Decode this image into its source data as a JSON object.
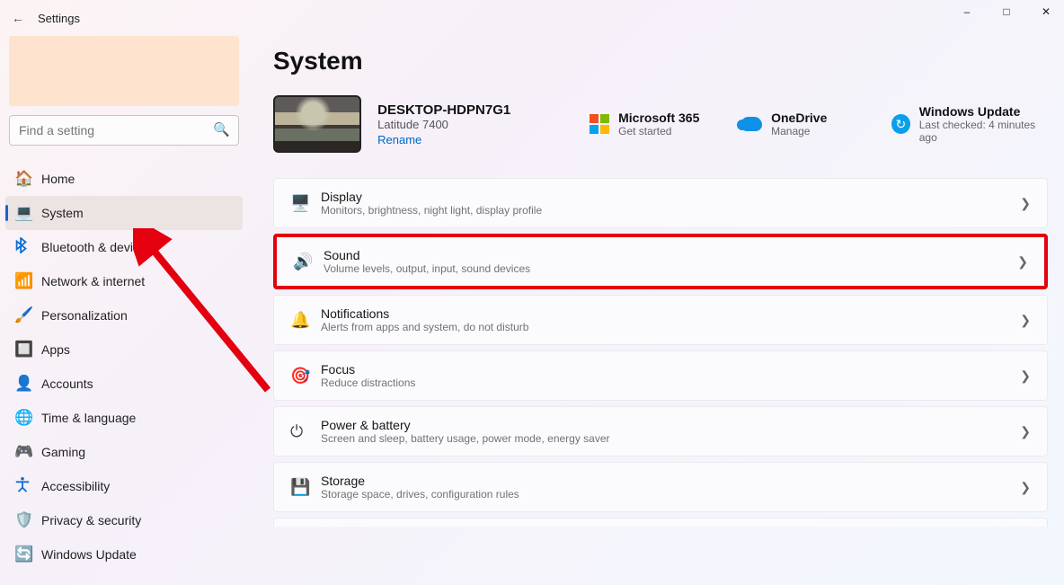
{
  "window": {
    "title": "Settings"
  },
  "search": {
    "placeholder": "Find a setting"
  },
  "nav": {
    "items": [
      {
        "label": "Home",
        "icon": "🏠"
      },
      {
        "label": "System",
        "icon": "💻"
      },
      {
        "label": "Bluetooth & devices",
        "icon_name": "bluetooth-icon"
      },
      {
        "label": "Network & internet",
        "icon": "📶"
      },
      {
        "label": "Personalization",
        "icon": "🖌️"
      },
      {
        "label": "Apps",
        "icon": "🔲"
      },
      {
        "label": "Accounts",
        "icon": "👤"
      },
      {
        "label": "Time & language",
        "icon": "🌐"
      },
      {
        "label": "Gaming",
        "icon": "🎮"
      },
      {
        "label": "Accessibility",
        "icon_name": "accessibility-icon"
      },
      {
        "label": "Privacy & security",
        "icon": "🛡️"
      },
      {
        "label": "Windows Update",
        "icon": "🔄"
      }
    ],
    "active_index": 1
  },
  "page": {
    "title": "System",
    "device": {
      "name": "DESKTOP-HDPN7G1",
      "model": "Latitude 7400",
      "rename_label": "Rename"
    },
    "links": {
      "m365": {
        "title": "Microsoft 365",
        "sub": "Get started"
      },
      "onedrive": {
        "title": "OneDrive",
        "sub": "Manage"
      },
      "update": {
        "title": "Windows Update",
        "sub": "Last checked: 4 minutes ago"
      }
    },
    "rows": [
      {
        "key": "display",
        "title": "Display",
        "sub": "Monitors, brightness, night light, display profile",
        "icon": "🖥️"
      },
      {
        "key": "sound",
        "title": "Sound",
        "sub": "Volume levels, output, input, sound devices",
        "icon": "🔊",
        "highlight": true
      },
      {
        "key": "notifications",
        "title": "Notifications",
        "sub": "Alerts from apps and system, do not disturb",
        "icon": "🔔"
      },
      {
        "key": "focus",
        "title": "Focus",
        "sub": "Reduce distractions",
        "icon": "🎯"
      },
      {
        "key": "power",
        "title": "Power & battery",
        "sub": "Screen and sleep, battery usage, power mode, energy saver",
        "icon": "⏻"
      },
      {
        "key": "storage",
        "title": "Storage",
        "sub": "Storage space, drives, configuration rules",
        "icon": "💾"
      }
    ]
  },
  "annotations": {
    "arrow_color": "#e4000f",
    "highlight_color": "#e4000f"
  }
}
